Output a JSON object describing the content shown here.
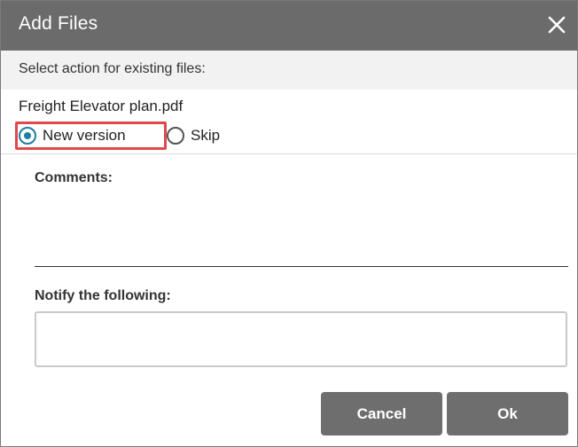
{
  "dialog": {
    "title": "Add Files",
    "close_icon": "close-icon"
  },
  "action_prompt": "Select action for existing files:",
  "file": {
    "name": "Freight Elevator plan.pdf",
    "options": [
      {
        "label": "New version",
        "selected": true
      },
      {
        "label": "Skip",
        "selected": false
      }
    ]
  },
  "comments": {
    "label": "Comments:",
    "value": ""
  },
  "notify": {
    "label": "Notify the following:",
    "value": ""
  },
  "buttons": {
    "cancel": "Cancel",
    "ok": "Ok"
  },
  "colors": {
    "titlebar": "#6b6b6b",
    "radio_accent": "#1d7fa3",
    "highlight": "#e0484d",
    "button": "#6e6e6e"
  }
}
